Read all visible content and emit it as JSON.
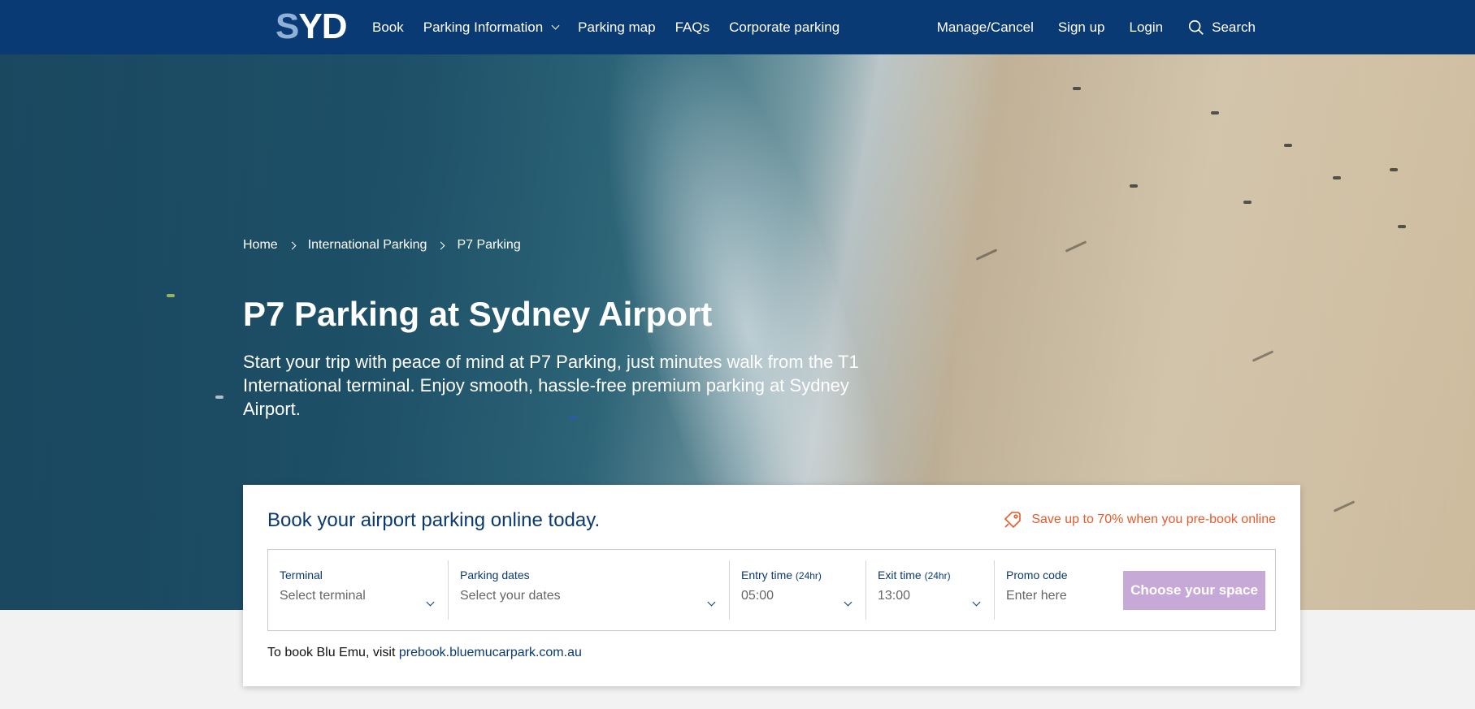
{
  "header": {
    "logo": "SYD",
    "nav_left": [
      {
        "label": "Book"
      },
      {
        "label": "Parking Information"
      },
      {
        "label": "Parking map"
      },
      {
        "label": "FAQs"
      },
      {
        "label": "Corporate parking"
      }
    ],
    "nav_right": [
      {
        "label": "Manage/Cancel"
      },
      {
        "label": "Sign up"
      },
      {
        "label": "Login"
      },
      {
        "label": "Search"
      }
    ]
  },
  "breadcrumb": [
    "Home",
    "International Parking",
    "P7 Parking"
  ],
  "hero": {
    "title": "P7 Parking at Sydney Airport",
    "subtitle": "Start your trip with peace of mind at P7 Parking, just minutes walk from the T1 International terminal. Enjoy smooth, hassle-free premium parking at Sydney Airport."
  },
  "booking": {
    "title": "Book your airport parking online today.",
    "promo_message": "Save up to 70% when you pre-book online",
    "fields": {
      "terminal": {
        "label": "Terminal",
        "value": "Select terminal"
      },
      "dates": {
        "label": "Parking dates",
        "value": "Select your dates"
      },
      "entry": {
        "label": "Entry time",
        "label_small": "(24hr)",
        "value": "05:00"
      },
      "exit": {
        "label": "Exit time",
        "label_small": "(24hr)",
        "value": "13:00"
      },
      "promo": {
        "label": "Promo code",
        "placeholder": "Enter here"
      }
    },
    "cta": "Choose your space",
    "blu_text": "To book Blu Emu, visit",
    "blu_link": "prebook.bluemucarpark.com.au"
  },
  "colors": {
    "navy": "#0a3a73",
    "accent_orange": "#e65a2b",
    "cta_purple": "#c6a9d6"
  }
}
